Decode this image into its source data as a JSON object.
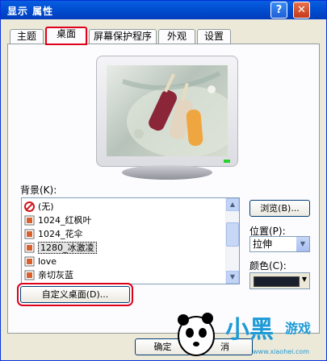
{
  "window": {
    "title": "显示 属性"
  },
  "titlebar_buttons": {
    "help": "?",
    "close": "✕"
  },
  "tabs": [
    {
      "label": "主题"
    },
    {
      "label": "桌面"
    },
    {
      "label": "屏幕保护程序"
    },
    {
      "label": "外观"
    },
    {
      "label": "设置"
    }
  ],
  "active_tab": "桌面",
  "background": {
    "label": "背景(K):",
    "items": [
      {
        "label": "(无)",
        "icon": "none-icon"
      },
      {
        "label": "1024_红枫叶",
        "icon": "image-icon"
      },
      {
        "label": "1024_花伞",
        "icon": "image-icon"
      },
      {
        "label": "1280_冰激凌",
        "icon": "image-icon"
      },
      {
        "label": "love",
        "icon": "image-icon"
      },
      {
        "label": "亲切灰蓝",
        "icon": "image-icon"
      }
    ],
    "selected": "1280_冰激凌"
  },
  "browse_button": "浏览(B)...",
  "position": {
    "label": "位置(P):",
    "value": "拉伸"
  },
  "color": {
    "label": "颜色(C):",
    "value": "#1a1f2e"
  },
  "custom_desktop_button": "自定义桌面(D)...",
  "footer": {
    "ok": "确定",
    "cancel": "消"
  },
  "logo": {
    "text_main": "小黑",
    "text_games": "游戏",
    "url": "www.xiaohei.com"
  },
  "colors": {
    "title_blue": "#0150d4",
    "highlight_red": "#e0001a"
  }
}
